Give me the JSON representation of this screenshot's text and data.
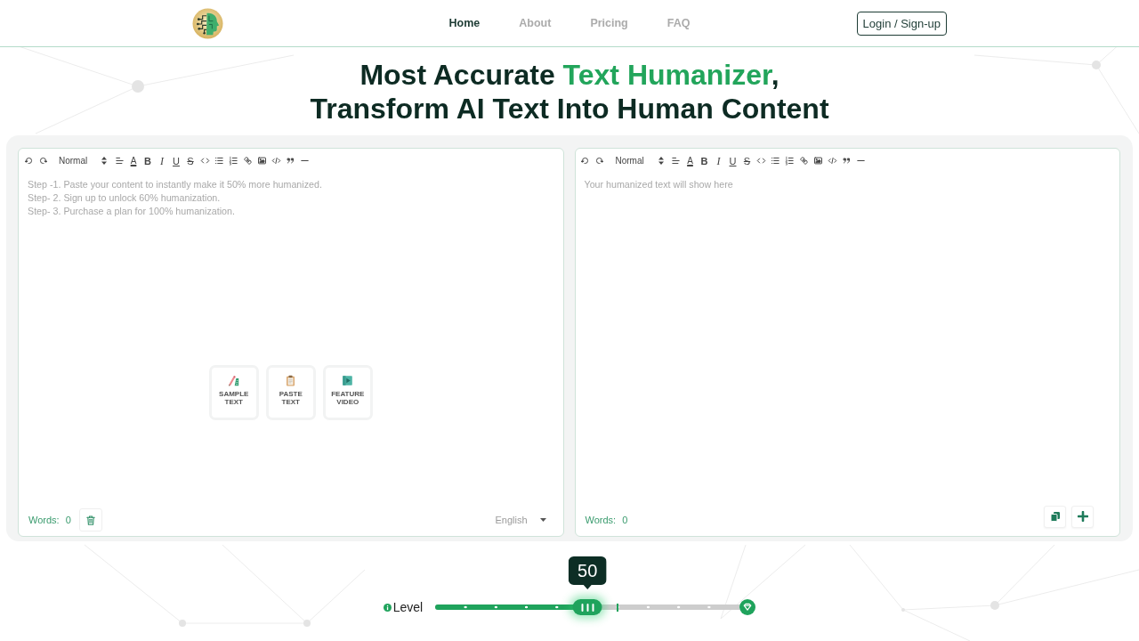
{
  "header": {
    "nav": [
      {
        "label": "Home",
        "selected": true
      },
      {
        "label": "About",
        "selected": false
      },
      {
        "label": "Pricing",
        "selected": false
      },
      {
        "label": "FAQ",
        "selected": false
      }
    ],
    "login_button": "Login / Sign-up"
  },
  "hero": {
    "title_lines": [
      [
        {
          "text": "Most Accurate ",
          "highlight": false
        },
        {
          "text": "Text Humanizer",
          "highlight": true
        },
        {
          "text": ",",
          "highlight": false
        }
      ],
      [
        {
          "text": "Transform AI Text Into Human Content",
          "highlight": false
        }
      ]
    ]
  },
  "input_editor": {
    "toolbar": {
      "format_select": "Normal",
      "letter_buttons": [
        "A",
        "B",
        "I",
        "U",
        "S"
      ]
    },
    "placeholder": "Step -1. Paste your content to instantly make it 50% more humanized.\nStep- 2. Sign up to unlock 60% humanization.\nStep- 3. Purchase a plan for 100% humanization.",
    "quick_actions": [
      {
        "kind": "sample",
        "label": "SAMPLE TEXT"
      },
      {
        "kind": "paste",
        "label": "PASTE TEXT"
      },
      {
        "kind": "video",
        "label": "FEATURE VIDEO"
      }
    ],
    "word_count_label": "Words:",
    "word_count": "0",
    "language": "English"
  },
  "output_editor": {
    "toolbar": {
      "format_select": "Normal",
      "letter_buttons": [
        "A",
        "B",
        "I",
        "U",
        "S"
      ]
    },
    "placeholder": "Your humanized text will show here",
    "word_count_label": "Words:",
    "word_count": "0"
  },
  "level_slider": {
    "label": "Level",
    "level": 0.5,
    "value_label": "50"
  }
}
